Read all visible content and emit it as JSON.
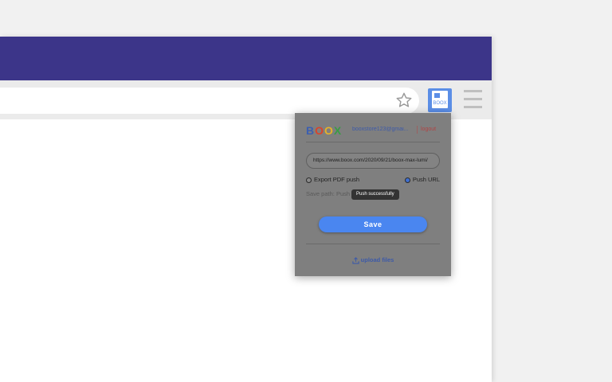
{
  "toolbar": {
    "star_icon": "star-outline-icon",
    "extension": {
      "icon": "boox-document-icon",
      "label": "BOOX"
    },
    "menu_icon": "hamburger-menu-icon"
  },
  "popup": {
    "logo": {
      "b": "B",
      "o1": "O",
      "o2": "O",
      "x": "X"
    },
    "account_email": "booxstore123@gmai...",
    "logout_label": "logout",
    "url_value": "https://www.boox.com/2020/09/21/boox-max-lumi/",
    "options": {
      "export_pdf": {
        "label": "Export PDF push",
        "selected": false
      },
      "push_url": {
        "label": "Push URL",
        "selected": true
      }
    },
    "save_path_label": "Save path: Push",
    "toast_text": "Push successfully",
    "save_label": "Save",
    "upload_label": "upload files",
    "upload_icon": "upload-icon"
  },
  "colors": {
    "titlebar": "#3c3589",
    "accent": "#4a86f0",
    "logout": "#b04444"
  }
}
